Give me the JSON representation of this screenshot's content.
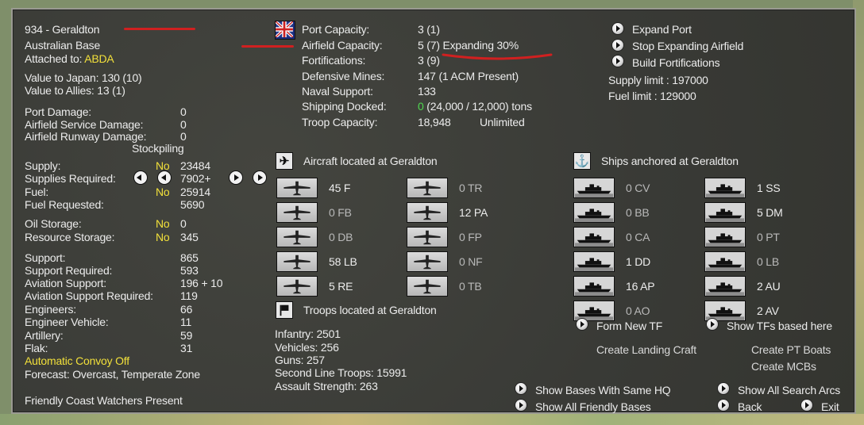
{
  "colors": {
    "highlight": "#f2e03a",
    "green": "#4fd64f",
    "text": "#ececec",
    "annotation": "#d02020"
  },
  "base": {
    "title": "934 - Geraldton",
    "type": "Australian Base",
    "attached_label": "Attached to:",
    "attached_value": "ABDA",
    "value_japan": "Value to Japan:  130 (10)",
    "value_allies": "Value to Allies:  13 (1)"
  },
  "damage": {
    "port_label": "Port Damage:",
    "port_value": "0",
    "airfield_service_label": "Airfield Service Damage:",
    "airfield_service_value": "0",
    "airfield_runway_label": "Airfield Runway Damage:",
    "airfield_runway_value": "0",
    "stockpiling": "Stockpiling"
  },
  "supply": {
    "supply_label": "Supply:",
    "supply_flag": "No",
    "supply_value": "23484",
    "supplies_required_label": "Supplies Required:",
    "supplies_required_value": "7902+",
    "fuel_label": "Fuel:",
    "fuel_flag": "No",
    "fuel_value": "25914",
    "fuel_requested_label": "Fuel Requested:",
    "fuel_requested_value": "5690",
    "oil_label": "Oil Storage:",
    "oil_flag": "No",
    "oil_value": "0",
    "resource_label": "Resource Storage:",
    "resource_flag": "No",
    "resource_value": "345"
  },
  "support": {
    "support_label": "Support:",
    "support_value": "865",
    "support_required_label": "Support Required:",
    "support_required_value": "593",
    "aviation_label": "Aviation Support:",
    "aviation_value": "196 + 10",
    "aviation_required_label": "Aviation Support Required:",
    "aviation_required_value": "119",
    "engineers_label": "Engineers:",
    "engineers_value": "66",
    "engineer_vehicle_label": "Engineer Vehicle:",
    "engineer_vehicle_value": "11",
    "artillery_label": "Artillery:",
    "artillery_value": "59",
    "flak_label": "Flak:",
    "flak_value": "31",
    "convoy": "Automatic Convoy Off",
    "forecast": "Forecast: Overcast, Temperate Zone",
    "coastwatchers": "Friendly Coast Watchers Present"
  },
  "capacity": {
    "port_label": "Port Capacity:",
    "port_value": "3 (1)",
    "airfield_label": "Airfield Capacity:",
    "airfield_value": "5 (7) Expanding 30%",
    "fort_label": "Fortifications:",
    "fort_value": "3 (9)",
    "mines_label": "Defensive Mines:",
    "mines_value": "147 (1 ACM Present)",
    "naval_label": "Naval Support:",
    "naval_value": "133",
    "shipping_label": "Shipping Docked:",
    "shipping_value_green": "0",
    "shipping_value_rest": " (24,000 / 12,000) tons",
    "troop_label": "Troop Capacity:",
    "troop_value": "18,948",
    "troop_unlimited": "Unlimited"
  },
  "actions": {
    "expand_port": "Expand Port",
    "stop_airfield": "Stop Expanding Airfield",
    "build_forts": "Build Fortifications",
    "supply_limit": "Supply limit : 197000",
    "fuel_limit": "Fuel limit : 129000"
  },
  "aircraft": {
    "header": "Aircraft located at Geraldton",
    "left": [
      {
        "label": "45 F"
      },
      {
        "label": "0 FB"
      },
      {
        "label": "0 DB"
      },
      {
        "label": "58 LB"
      },
      {
        "label": "5 RE"
      }
    ],
    "right": [
      {
        "label": "0 TR"
      },
      {
        "label": "12 PA"
      },
      {
        "label": "0 FP"
      },
      {
        "label": "0 NF"
      },
      {
        "label": "0 TB"
      }
    ]
  },
  "troops": {
    "header": "Troops located at Geraldton",
    "infantry": "Infantry: 2501",
    "vehicles": "Vehicles: 256",
    "guns": "Guns: 257",
    "second_line": "Second Line Troops: 15991",
    "assault": "Assault Strength: 263"
  },
  "ships": {
    "header": "Ships anchored at Geraldton",
    "left": [
      {
        "label": "0 CV"
      },
      {
        "label": "0 BB"
      },
      {
        "label": "0 CA"
      },
      {
        "label": "1 DD"
      },
      {
        "label": "16 AP"
      },
      {
        "label": "0 AO"
      }
    ],
    "right": [
      {
        "label": "1 SS"
      },
      {
        "label": "5 DM"
      },
      {
        "label": "0 PT"
      },
      {
        "label": "0 LB"
      },
      {
        "label": "2 AU"
      },
      {
        "label": "2 AV"
      }
    ],
    "form_tf": "Form New TF",
    "show_tfs": "Show TFs based here",
    "landing_craft": "Create Landing Craft",
    "pt_boats": "Create PT Boats",
    "mcbs": "Create MCBs"
  },
  "footer": {
    "same_hq": "Show Bases With Same HQ",
    "all_friendly": "Show All Friendly Bases",
    "search_arcs": "Show All Search Arcs",
    "back": "Back",
    "exit": "Exit"
  }
}
